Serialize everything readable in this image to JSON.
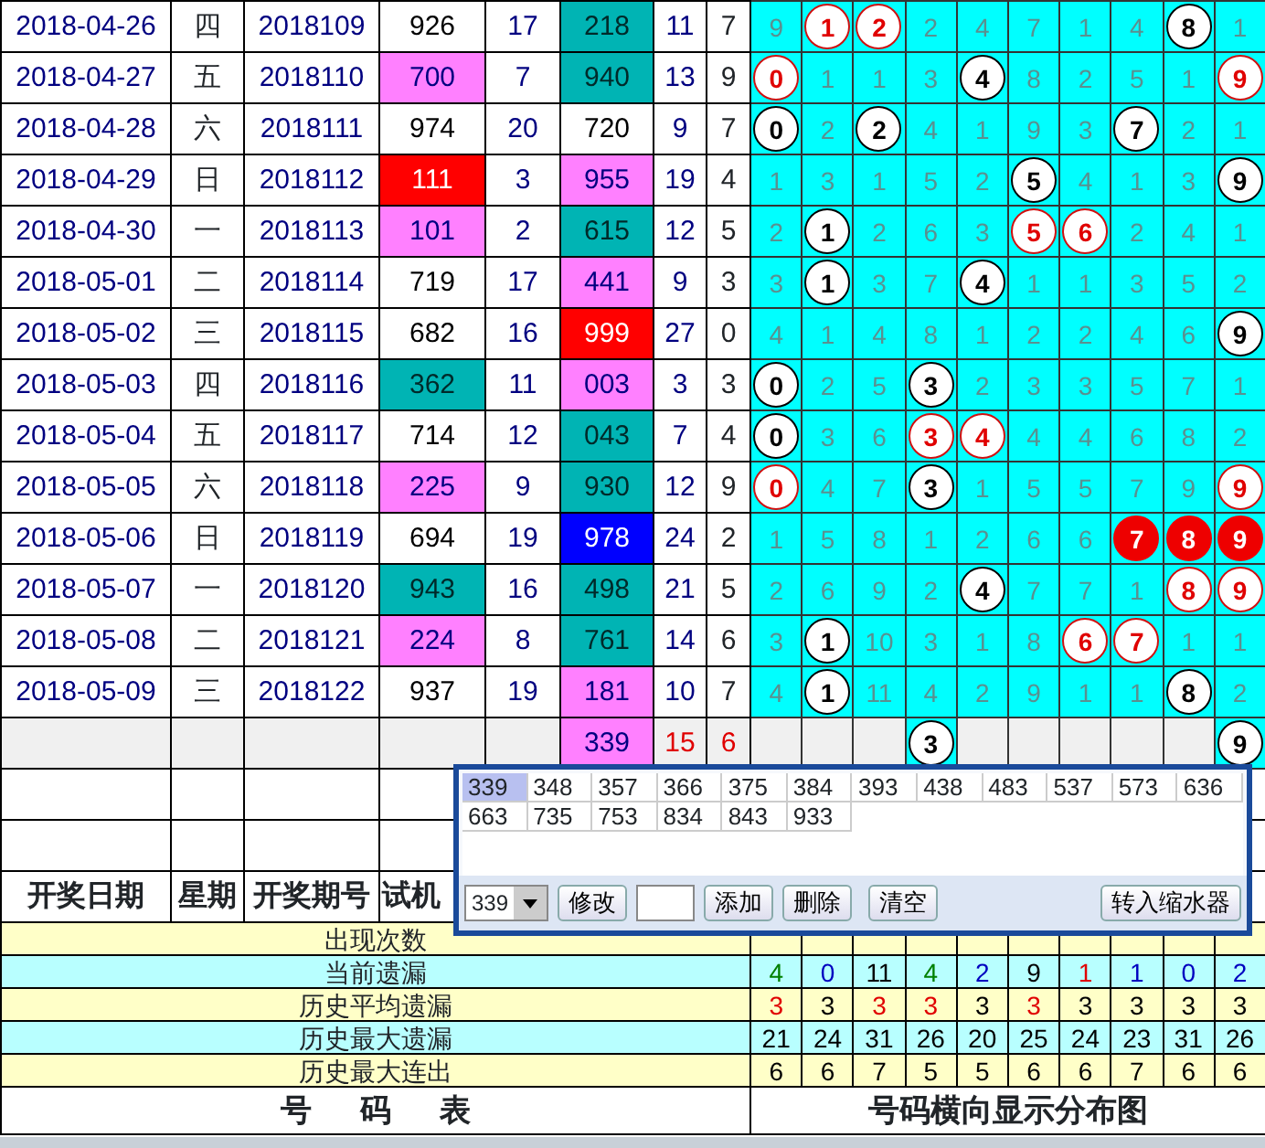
{
  "rows": [
    {
      "kind": "draw",
      "date": "2018-04-26",
      "weekday": "四",
      "issue": "2018109",
      "trial": {
        "value": "926",
        "color": "#ffffff"
      },
      "trial_sum": "17",
      "draw": {
        "value": "218",
        "color": "#00b4b4"
      },
      "sum": "11",
      "span": "7",
      "cells": [
        {
          "text": "9",
          "kind": "miss"
        },
        {
          "text": "1",
          "kind": "repeat"
        },
        {
          "text": "2",
          "kind": "repeat"
        },
        {
          "text": "2",
          "kind": "miss"
        },
        {
          "text": "4",
          "kind": "miss"
        },
        {
          "text": "7",
          "kind": "miss"
        },
        {
          "text": "1",
          "kind": "miss"
        },
        {
          "text": "4",
          "kind": "miss"
        },
        {
          "text": "8",
          "kind": "hit"
        },
        {
          "text": "1",
          "kind": "miss"
        }
      ]
    },
    {
      "kind": "draw",
      "date": "2018-04-27",
      "weekday": "五",
      "issue": "2018110",
      "trial": {
        "value": "700",
        "color": "#ff80ff"
      },
      "trial_sum": "7",
      "draw": {
        "value": "940",
        "color": "#00b4b4"
      },
      "sum": "13",
      "span": "9",
      "cells": [
        {
          "text": "0",
          "kind": "repeat"
        },
        {
          "text": "1",
          "kind": "miss"
        },
        {
          "text": "1",
          "kind": "miss"
        },
        {
          "text": "3",
          "kind": "miss"
        },
        {
          "text": "4",
          "kind": "hit"
        },
        {
          "text": "8",
          "kind": "miss"
        },
        {
          "text": "2",
          "kind": "miss"
        },
        {
          "text": "5",
          "kind": "miss"
        },
        {
          "text": "1",
          "kind": "miss"
        },
        {
          "text": "9",
          "kind": "repeat"
        }
      ]
    },
    {
      "kind": "draw",
      "date": "2018-04-28",
      "weekday": "六",
      "issue": "2018111",
      "trial": {
        "value": "974",
        "color": "#ffffff"
      },
      "trial_sum": "20",
      "draw": {
        "value": "720",
        "color": "#ffffff"
      },
      "sum": "9",
      "span": "7",
      "cells": [
        {
          "text": "0",
          "kind": "hit"
        },
        {
          "text": "2",
          "kind": "miss"
        },
        {
          "text": "2",
          "kind": "hit"
        },
        {
          "text": "4",
          "kind": "miss"
        },
        {
          "text": "1",
          "kind": "miss"
        },
        {
          "text": "9",
          "kind": "miss"
        },
        {
          "text": "3",
          "kind": "miss"
        },
        {
          "text": "7",
          "kind": "hit"
        },
        {
          "text": "2",
          "kind": "miss"
        },
        {
          "text": "1",
          "kind": "miss"
        }
      ]
    },
    {
      "kind": "draw",
      "date": "2018-04-29",
      "weekday": "日",
      "issue": "2018112",
      "trial": {
        "value": "111",
        "color": "#ff0000"
      },
      "trial_sum": "3",
      "draw": {
        "value": "955",
        "color": "#ff80ff"
      },
      "sum": "19",
      "span": "4",
      "cells": [
        {
          "text": "1",
          "kind": "miss"
        },
        {
          "text": "3",
          "kind": "miss"
        },
        {
          "text": "1",
          "kind": "miss"
        },
        {
          "text": "5",
          "kind": "miss"
        },
        {
          "text": "2",
          "kind": "miss"
        },
        {
          "text": "5",
          "kind": "hit"
        },
        {
          "text": "4",
          "kind": "miss"
        },
        {
          "text": "1",
          "kind": "miss"
        },
        {
          "text": "3",
          "kind": "miss"
        },
        {
          "text": "9",
          "kind": "hit"
        }
      ]
    },
    {
      "kind": "draw",
      "date": "2018-04-30",
      "weekday": "一",
      "issue": "2018113",
      "trial": {
        "value": "101",
        "color": "#ff80ff"
      },
      "trial_sum": "2",
      "draw": {
        "value": "615",
        "color": "#00b4b4"
      },
      "sum": "12",
      "span": "5",
      "cells": [
        {
          "text": "2",
          "kind": "miss"
        },
        {
          "text": "1",
          "kind": "hit"
        },
        {
          "text": "2",
          "kind": "miss"
        },
        {
          "text": "6",
          "kind": "miss"
        },
        {
          "text": "3",
          "kind": "miss"
        },
        {
          "text": "5",
          "kind": "repeat"
        },
        {
          "text": "6",
          "kind": "repeat"
        },
        {
          "text": "2",
          "kind": "miss"
        },
        {
          "text": "4",
          "kind": "miss"
        },
        {
          "text": "1",
          "kind": "miss"
        }
      ]
    },
    {
      "kind": "draw",
      "date": "2018-05-01",
      "weekday": "二",
      "issue": "2018114",
      "trial": {
        "value": "719",
        "color": "#ffffff"
      },
      "trial_sum": "17",
      "draw": {
        "value": "441",
        "color": "#ff80ff"
      },
      "sum": "9",
      "span": "3",
      "cells": [
        {
          "text": "3",
          "kind": "miss"
        },
        {
          "text": "1",
          "kind": "hit"
        },
        {
          "text": "3",
          "kind": "miss"
        },
        {
          "text": "7",
          "kind": "miss"
        },
        {
          "text": "4",
          "kind": "hit"
        },
        {
          "text": "1",
          "kind": "miss"
        },
        {
          "text": "1",
          "kind": "miss"
        },
        {
          "text": "3",
          "kind": "miss"
        },
        {
          "text": "5",
          "kind": "miss"
        },
        {
          "text": "2",
          "kind": "miss"
        }
      ]
    },
    {
      "kind": "draw",
      "date": "2018-05-02",
      "weekday": "三",
      "issue": "2018115",
      "trial": {
        "value": "682",
        "color": "#ffffff"
      },
      "trial_sum": "16",
      "draw": {
        "value": "999",
        "color": "#ff0000"
      },
      "sum": "27",
      "span": "0",
      "cells": [
        {
          "text": "4",
          "kind": "miss"
        },
        {
          "text": "1",
          "kind": "miss"
        },
        {
          "text": "4",
          "kind": "miss"
        },
        {
          "text": "8",
          "kind": "miss"
        },
        {
          "text": "1",
          "kind": "miss"
        },
        {
          "text": "2",
          "kind": "miss"
        },
        {
          "text": "2",
          "kind": "miss"
        },
        {
          "text": "4",
          "kind": "miss"
        },
        {
          "text": "6",
          "kind": "miss"
        },
        {
          "text": "9",
          "kind": "hit"
        }
      ]
    },
    {
      "kind": "draw",
      "date": "2018-05-03",
      "weekday": "四",
      "issue": "2018116",
      "trial": {
        "value": "362",
        "color": "#00b4b4"
      },
      "trial_sum": "11",
      "draw": {
        "value": "003",
        "color": "#ff80ff"
      },
      "sum": "3",
      "span": "3",
      "cells": [
        {
          "text": "0",
          "kind": "hit"
        },
        {
          "text": "2",
          "kind": "miss"
        },
        {
          "text": "5",
          "kind": "miss"
        },
        {
          "text": "3",
          "kind": "hit"
        },
        {
          "text": "2",
          "kind": "miss"
        },
        {
          "text": "3",
          "kind": "miss"
        },
        {
          "text": "3",
          "kind": "miss"
        },
        {
          "text": "5",
          "kind": "miss"
        },
        {
          "text": "7",
          "kind": "miss"
        },
        {
          "text": "1",
          "kind": "miss"
        }
      ]
    },
    {
      "kind": "draw",
      "date": "2018-05-04",
      "weekday": "五",
      "issue": "2018117",
      "trial": {
        "value": "714",
        "color": "#ffffff"
      },
      "trial_sum": "12",
      "draw": {
        "value": "043",
        "color": "#00b4b4"
      },
      "sum": "7",
      "span": "4",
      "cells": [
        {
          "text": "0",
          "kind": "hit"
        },
        {
          "text": "3",
          "kind": "miss"
        },
        {
          "text": "6",
          "kind": "miss"
        },
        {
          "text": "3",
          "kind": "repeat"
        },
        {
          "text": "4",
          "kind": "repeat"
        },
        {
          "text": "4",
          "kind": "miss"
        },
        {
          "text": "4",
          "kind": "miss"
        },
        {
          "text": "6",
          "kind": "miss"
        },
        {
          "text": "8",
          "kind": "miss"
        },
        {
          "text": "2",
          "kind": "miss"
        }
      ]
    },
    {
      "kind": "draw",
      "date": "2018-05-05",
      "weekday": "六",
      "issue": "2018118",
      "trial": {
        "value": "225",
        "color": "#ff80ff"
      },
      "trial_sum": "9",
      "draw": {
        "value": "930",
        "color": "#00b4b4"
      },
      "sum": "12",
      "span": "9",
      "cells": [
        {
          "text": "0",
          "kind": "repeat"
        },
        {
          "text": "4",
          "kind": "miss"
        },
        {
          "text": "7",
          "kind": "miss"
        },
        {
          "text": "3",
          "kind": "hit"
        },
        {
          "text": "1",
          "kind": "miss"
        },
        {
          "text": "5",
          "kind": "miss"
        },
        {
          "text": "5",
          "kind": "miss"
        },
        {
          "text": "7",
          "kind": "miss"
        },
        {
          "text": "9",
          "kind": "miss"
        },
        {
          "text": "9",
          "kind": "repeat"
        }
      ]
    },
    {
      "kind": "draw",
      "date": "2018-05-06",
      "weekday": "日",
      "issue": "2018119",
      "trial": {
        "value": "694",
        "color": "#ffffff"
      },
      "trial_sum": "19",
      "draw": {
        "value": "978",
        "color": "#0000ff"
      },
      "sum": "24",
      "span": "2",
      "cells": [
        {
          "text": "1",
          "kind": "miss"
        },
        {
          "text": "5",
          "kind": "miss"
        },
        {
          "text": "8",
          "kind": "miss"
        },
        {
          "text": "1",
          "kind": "miss"
        },
        {
          "text": "2",
          "kind": "miss"
        },
        {
          "text": "6",
          "kind": "miss"
        },
        {
          "text": "6",
          "kind": "miss"
        },
        {
          "text": "7",
          "kind": "triple"
        },
        {
          "text": "8",
          "kind": "triple"
        },
        {
          "text": "9",
          "kind": "triple"
        }
      ]
    },
    {
      "kind": "draw",
      "date": "2018-05-07",
      "weekday": "一",
      "issue": "2018120",
      "trial": {
        "value": "943",
        "color": "#00b4b4"
      },
      "trial_sum": "16",
      "draw": {
        "value": "498",
        "color": "#00b4b4"
      },
      "sum": "21",
      "span": "5",
      "cells": [
        {
          "text": "2",
          "kind": "miss"
        },
        {
          "text": "6",
          "kind": "miss"
        },
        {
          "text": "9",
          "kind": "miss"
        },
        {
          "text": "2",
          "kind": "miss"
        },
        {
          "text": "4",
          "kind": "hit"
        },
        {
          "text": "7",
          "kind": "miss"
        },
        {
          "text": "7",
          "kind": "miss"
        },
        {
          "text": "1",
          "kind": "miss"
        },
        {
          "text": "8",
          "kind": "repeat"
        },
        {
          "text": "9",
          "kind": "repeat"
        }
      ]
    },
    {
      "kind": "draw",
      "date": "2018-05-08",
      "weekday": "二",
      "issue": "2018121",
      "trial": {
        "value": "224",
        "color": "#ff80ff"
      },
      "trial_sum": "8",
      "draw": {
        "value": "761",
        "color": "#00b4b4"
      },
      "sum": "14",
      "span": "6",
      "cells": [
        {
          "text": "3",
          "kind": "miss"
        },
        {
          "text": "1",
          "kind": "hit"
        },
        {
          "text": "10",
          "kind": "miss"
        },
        {
          "text": "3",
          "kind": "miss"
        },
        {
          "text": "1",
          "kind": "miss"
        },
        {
          "text": "8",
          "kind": "miss"
        },
        {
          "text": "6",
          "kind": "repeat"
        },
        {
          "text": "7",
          "kind": "repeat"
        },
        {
          "text": "1",
          "kind": "miss"
        },
        {
          "text": "1",
          "kind": "miss"
        }
      ]
    },
    {
      "kind": "draw",
      "date": "2018-05-09",
      "weekday": "三",
      "issue": "2018122",
      "trial": {
        "value": "937",
        "color": "#ffffff"
      },
      "trial_sum": "19",
      "draw": {
        "value": "181",
        "color": "#ff80ff"
      },
      "sum": "10",
      "span": "7",
      "cells": [
        {
          "text": "4",
          "kind": "miss"
        },
        {
          "text": "1",
          "kind": "hit"
        },
        {
          "text": "11",
          "kind": "miss"
        },
        {
          "text": "4",
          "kind": "miss"
        },
        {
          "text": "2",
          "kind": "miss"
        },
        {
          "text": "9",
          "kind": "miss"
        },
        {
          "text": "1",
          "kind": "miss"
        },
        {
          "text": "1",
          "kind": "miss"
        },
        {
          "text": "8",
          "kind": "hit"
        },
        {
          "text": "2",
          "kind": "miss"
        }
      ]
    },
    {
      "kind": "forecast",
      "draw": {
        "value": "339",
        "color": "#ff80ff"
      },
      "sum": "15",
      "span": "6",
      "cells": [
        {
          "kind": "blank"
        },
        {
          "kind": "blank"
        },
        {
          "kind": "blank"
        },
        {
          "text": "3",
          "kind": "hit"
        },
        {
          "kind": "blank"
        },
        {
          "kind": "blank"
        },
        {
          "kind": "blank"
        },
        {
          "kind": "blank"
        },
        {
          "kind": "blank"
        },
        {
          "text": "9",
          "kind": "hit"
        }
      ]
    }
  ],
  "header": [
    "开奖日期",
    "星期",
    "开奖期号",
    "试机"
  ],
  "stats": [
    {
      "label": "出现次数"
    },
    {
      "label": "当前遗漏",
      "values": [
        {
          "text": "4",
          "color": "#008000"
        },
        {
          "text": "0",
          "color": "#0000c0"
        },
        {
          "text": "11",
          "color": "#000000"
        },
        {
          "text": "4",
          "color": "#008000"
        },
        {
          "text": "2",
          "color": "#0000c0"
        },
        {
          "text": "9",
          "color": "#000000"
        },
        {
          "text": "1",
          "color": "#e00000"
        },
        {
          "text": "1",
          "color": "#0000c0"
        },
        {
          "text": "0",
          "color": "#0000c0"
        },
        {
          "text": "2",
          "color": "#0000c0"
        }
      ]
    },
    {
      "label": "历史平均遗漏",
      "values": [
        {
          "text": "3",
          "color": "#e00000"
        },
        {
          "text": "3",
          "color": "#000000"
        },
        {
          "text": "3",
          "color": "#e00000"
        },
        {
          "text": "3",
          "color": "#e00000"
        },
        {
          "text": "3",
          "color": "#000000"
        },
        {
          "text": "3",
          "color": "#e00000"
        },
        {
          "text": "3",
          "color": "#000000"
        },
        {
          "text": "3",
          "color": "#000000"
        },
        {
          "text": "3",
          "color": "#000000"
        },
        {
          "text": "3",
          "color": "#000000"
        }
      ]
    },
    {
      "label": "历史最大遗漏",
      "values": [
        {
          "text": "21",
          "color": "#000000"
        },
        {
          "text": "24",
          "color": "#000000"
        },
        {
          "text": "31",
          "color": "#000000"
        },
        {
          "text": "26",
          "color": "#000000"
        },
        {
          "text": "20",
          "color": "#000000"
        },
        {
          "text": "25",
          "color": "#000000"
        },
        {
          "text": "24",
          "color": "#000000"
        },
        {
          "text": "23",
          "color": "#000000"
        },
        {
          "text": "31",
          "color": "#000000"
        },
        {
          "text": "26",
          "color": "#000000"
        }
      ]
    },
    {
      "label": "历史最大连出",
      "values": [
        {
          "text": "6",
          "color": "#000000"
        },
        {
          "text": "6",
          "color": "#000000"
        },
        {
          "text": "7",
          "color": "#000000"
        },
        {
          "text": "5",
          "color": "#000000"
        },
        {
          "text": "5",
          "color": "#000000"
        },
        {
          "text": "6",
          "color": "#000000"
        },
        {
          "text": "6",
          "color": "#000000"
        },
        {
          "text": "7",
          "color": "#000000"
        },
        {
          "text": "6",
          "color": "#000000"
        },
        {
          "text": "6",
          "color": "#000000"
        }
      ]
    }
  ],
  "footer": {
    "left": "号 码 表",
    "right": "号码横向显示分布图"
  },
  "picker": {
    "numbers": [
      {
        "text": "339",
        "selected": true
      },
      {
        "text": "348",
        "selected": false
      },
      {
        "text": "357",
        "selected": false
      },
      {
        "text": "366",
        "selected": false
      },
      {
        "text": "375",
        "selected": false
      },
      {
        "text": "384",
        "selected": false
      },
      {
        "text": "393",
        "selected": false
      },
      {
        "text": "438",
        "selected": false
      },
      {
        "text": "483",
        "selected": false
      },
      {
        "text": "537",
        "selected": false
      },
      {
        "text": "573",
        "selected": false
      },
      {
        "text": "636",
        "selected": false
      },
      {
        "text": "663",
        "selected": false
      },
      {
        "text": "735",
        "selected": false
      },
      {
        "text": "753",
        "selected": false
      },
      {
        "text": "834",
        "selected": false
      },
      {
        "text": "843",
        "selected": false
      },
      {
        "text": "933",
        "selected": false
      }
    ],
    "select_value": "339",
    "buttons": [
      "修改",
      "添加",
      "删除",
      "清空"
    ],
    "transfer_button": "转入缩水器"
  }
}
